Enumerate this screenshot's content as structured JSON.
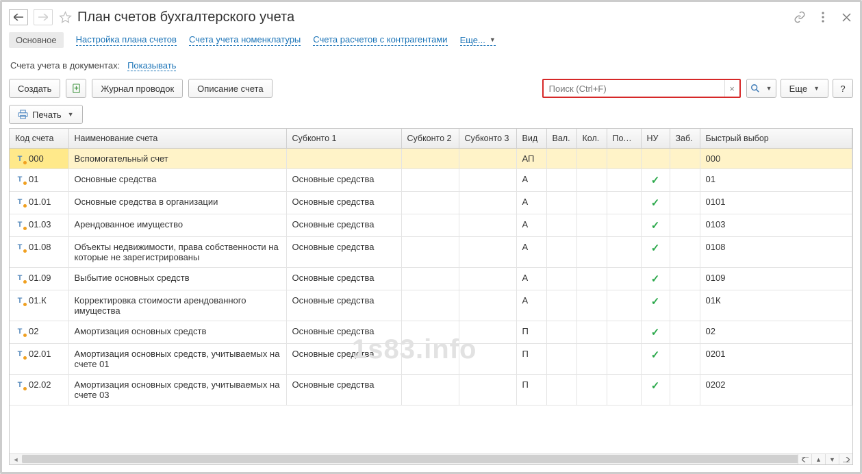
{
  "title": "План счетов бухгалтерского учета",
  "tabs": {
    "main": "Основное",
    "t1": "Настройка плана счетов",
    "t2": "Счета учета номенклатуры",
    "t3": "Счета расчетов с контрагентами",
    "more": "Еще..."
  },
  "info": {
    "label": "Счета учета в документах:",
    "link": "Показывать"
  },
  "toolbar": {
    "create": "Создать",
    "journal": "Журнал проводок",
    "describe": "Описание счета",
    "search_placeholder": "Поиск (Ctrl+F)",
    "more": "Еще",
    "help": "?"
  },
  "print": {
    "label": "Печать"
  },
  "columns": {
    "code": "Код счета",
    "name": "Наименование счета",
    "sk1": "Субконто 1",
    "sk2": "Субконто 2",
    "sk3": "Субконто 3",
    "vid": "Вид",
    "val": "Вал.",
    "kol": "Кол.",
    "podr": "Подр.",
    "nu": "НУ",
    "zab": "Заб.",
    "quick": "Быстрый выбор"
  },
  "rows": [
    {
      "code": "000",
      "name": "Вспомогательный счет",
      "sk1": "",
      "vid": "АП",
      "nu": false,
      "quick": "000",
      "selected": true
    },
    {
      "code": "01",
      "name": "Основные средства",
      "sk1": "Основные средства",
      "vid": "А",
      "nu": true,
      "quick": "01"
    },
    {
      "code": "01.01",
      "name": "Основные средства в организации",
      "sk1": "Основные средства",
      "vid": "А",
      "nu": true,
      "quick": "0101"
    },
    {
      "code": "01.03",
      "name": "Арендованное имущество",
      "sk1": "Основные средства",
      "vid": "А",
      "nu": true,
      "quick": "0103"
    },
    {
      "code": "01.08",
      "name": "Объекты недвижимости, права собственности на которые не зарегистрированы",
      "sk1": "Основные средства",
      "vid": "А",
      "nu": true,
      "quick": "0108"
    },
    {
      "code": "01.09",
      "name": "Выбытие основных средств",
      "sk1": "Основные средства",
      "vid": "А",
      "nu": true,
      "quick": "0109"
    },
    {
      "code": "01.К",
      "name": "Корректировка стоимости арендованного имущества",
      "sk1": "Основные средства",
      "vid": "А",
      "nu": true,
      "quick": "01К"
    },
    {
      "code": "02",
      "name": "Амортизация основных средств",
      "sk1": "Основные средства",
      "vid": "П",
      "nu": true,
      "quick": "02"
    },
    {
      "code": "02.01",
      "name": "Амортизация основных средств, учитываемых на счете 01",
      "sk1": "Основные средства",
      "vid": "П",
      "nu": true,
      "quick": "0201"
    },
    {
      "code": "02.02",
      "name": "Амортизация основных средств, учитываемых на счете 03",
      "sk1": "Основные средства",
      "vid": "П",
      "nu": true,
      "quick": "0202"
    }
  ],
  "watermark": "1s83.info"
}
